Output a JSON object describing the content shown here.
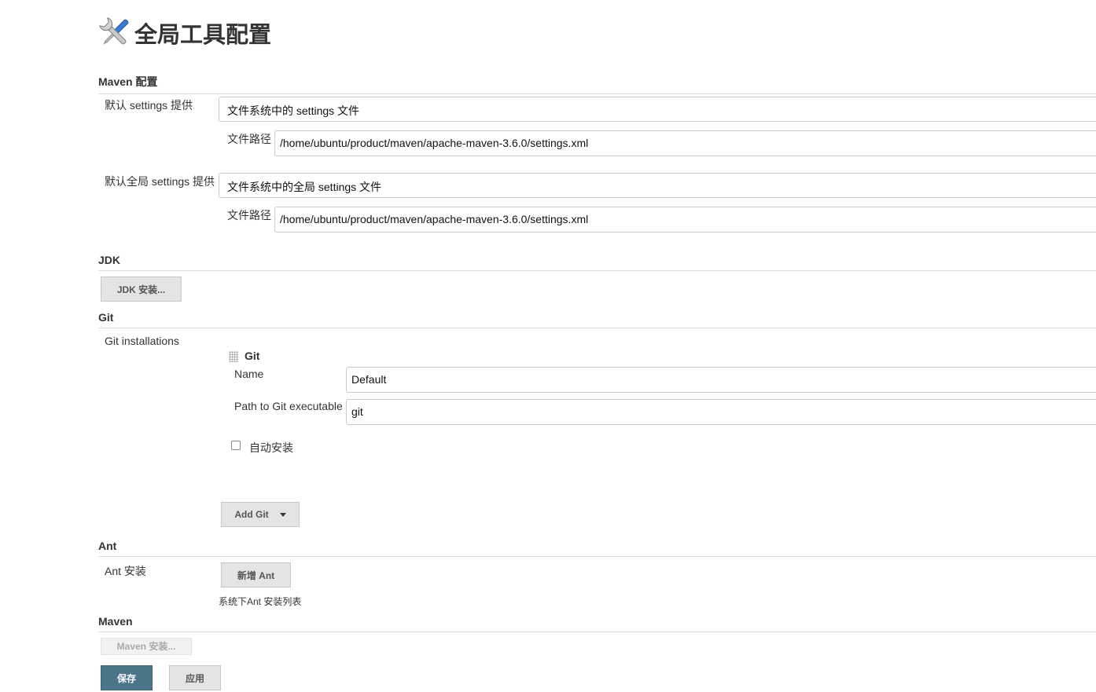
{
  "page": {
    "title": "全局工具配置",
    "icon": "tools-icon"
  },
  "maven_config": {
    "header": "Maven 配置",
    "default_settings_label": "默认 settings 提供",
    "default_settings_value": "文件系统中的 settings 文件",
    "default_settings_path_label": "文件路径",
    "default_settings_path_value": "/home/ubuntu/product/maven/apache-maven-3.6.0/settings.xml",
    "global_settings_label": "默认全局 settings 提供",
    "global_settings_value": "文件系统中的全局 settings 文件",
    "global_settings_path_label": "文件路径",
    "global_settings_path_value": "/home/ubuntu/product/maven/apache-maven-3.6.0/settings.xml"
  },
  "jdk": {
    "header": "JDK",
    "install_button": "JDK 安装..."
  },
  "git": {
    "header": "Git",
    "installations_label": "Git installations",
    "item_title": "Git",
    "name_label": "Name",
    "name_value": "Default",
    "path_label": "Path to Git executable",
    "path_value": "git",
    "auto_install_label": "自动安装",
    "auto_install_checked": false,
    "add_button": "Add Git"
  },
  "ant": {
    "header": "Ant",
    "install_label": "Ant 安装",
    "add_button": "新增 Ant",
    "note": "系统下Ant 安装列表"
  },
  "maven": {
    "header": "Maven",
    "install_button": "Maven 安装..."
  },
  "footer": {
    "save_button": "保存",
    "apply_button": "应用"
  },
  "colors": {
    "primary_button": "#4b758b",
    "button_gray": "#e4e4e4",
    "border": "#cccccc"
  }
}
